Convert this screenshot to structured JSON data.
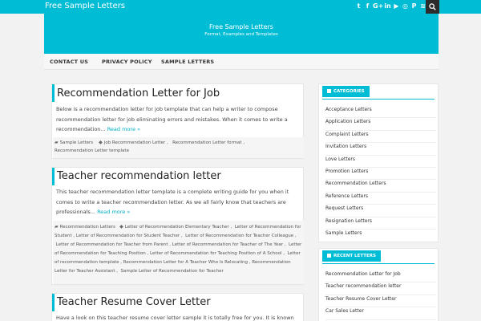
{
  "topbar": {
    "site_name": "Free Sample Letters",
    "social_icons": [
      "twitter-icon",
      "facebook-icon",
      "google-plus-icon",
      "linkedin-icon",
      "youtube-icon",
      "instagram-icon",
      "pinterest-icon",
      "rss-icon"
    ],
    "social_glyphs": [
      "t",
      "f",
      "G+",
      "in",
      "▶",
      "◎",
      "P",
      "≋"
    ]
  },
  "header": {
    "title": "Free Sample Letters",
    "tagline": "Format, Examples and Templates"
  },
  "nav": {
    "items": [
      "CONTACT US",
      "PRIVACY POLICY",
      "SAMPLE LETTERS"
    ]
  },
  "posts": [
    {
      "title": "Recommendation Letter for Job",
      "excerpt": "Below is a recommendation letter for job template that can help a writer to compose recommendation letter for job eliminating errors and mistakes. When it comes to write a recommendation...",
      "read_more": "Read more »",
      "category": "Sample Letters",
      "tags": [
        "job Recommendation Letter",
        "Recommendation Letter format",
        "Recommendation Letter template"
      ]
    },
    {
      "title": "Teacher recommendation letter",
      "excerpt": "This teacher recommendation letter template is a complete writing guide for you when it comes to write a teacher recommendation letter. As we all fairly know that teachers are professionals...",
      "read_more": "Read more »",
      "category": "Recommendation Letters",
      "tags": [
        "Letter of Recommendation Elementary Teacher",
        "Letter of Recommendation for Student",
        "Letter of Recommendation for Student Teacher",
        "Letter of Recommendation for Teacher Colleague",
        "Letter of Recommendation for Teacher from Parent",
        "Letter of Recommendation for Teacher of The Year",
        "Letter of Recommendation for Teaching Position",
        "Letter of Recommendation for Teaching Position of A School",
        "Letter of recommendation template",
        "Recommendation Letter for A Teacher Who Is Relocating",
        "Recommendation Letter for Teacher Assistant",
        "Sample Letter of Recommendation for Teacher"
      ]
    },
    {
      "title": "Teacher Resume Cover Letter",
      "excerpt": "Have a look on this teacher resume cover letter sample it is totally free for you. It is known"
    }
  ],
  "sidebar": {
    "categories": {
      "heading": "CATEGORIES",
      "items": [
        "Acceptance Letters",
        "Application Letters",
        "Complaint Letters",
        "Invitation Letters",
        "Love Letters",
        "Promotion Letters",
        "Recommendation Letters",
        "Reference Letters",
        "Request Letters",
        "Resignation Letters",
        "Sample Letters"
      ]
    },
    "recent": {
      "heading": "RECENT LETTERS",
      "items": [
        "Recommendation Letter for Job",
        "Teacher recommendation letter",
        "Teacher Resume Cover Letter",
        "Car Sales Letter"
      ]
    }
  },
  "colors": {
    "accent": "#00bcd4",
    "link": "#00acc1",
    "search_bg": "#2c2c2c"
  }
}
